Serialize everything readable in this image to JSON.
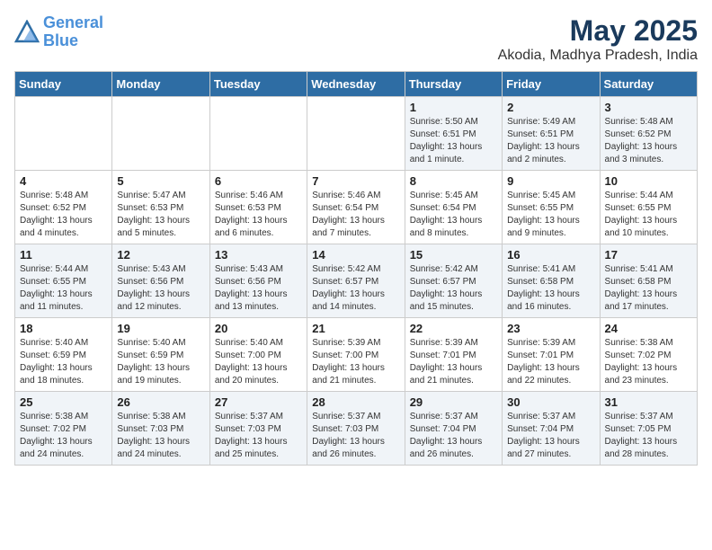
{
  "logo": {
    "line1": "General",
    "line2": "Blue"
  },
  "title": "May 2025",
  "subtitle": "Akodia, Madhya Pradesh, India",
  "weekdays": [
    "Sunday",
    "Monday",
    "Tuesday",
    "Wednesday",
    "Thursday",
    "Friday",
    "Saturday"
  ],
  "weeks": [
    [
      {
        "day": "",
        "info": ""
      },
      {
        "day": "",
        "info": ""
      },
      {
        "day": "",
        "info": ""
      },
      {
        "day": "",
        "info": ""
      },
      {
        "day": "1",
        "info": "Sunrise: 5:50 AM\nSunset: 6:51 PM\nDaylight: 13 hours and 1 minute."
      },
      {
        "day": "2",
        "info": "Sunrise: 5:49 AM\nSunset: 6:51 PM\nDaylight: 13 hours and 2 minutes."
      },
      {
        "day": "3",
        "info": "Sunrise: 5:48 AM\nSunset: 6:52 PM\nDaylight: 13 hours and 3 minutes."
      }
    ],
    [
      {
        "day": "4",
        "info": "Sunrise: 5:48 AM\nSunset: 6:52 PM\nDaylight: 13 hours and 4 minutes."
      },
      {
        "day": "5",
        "info": "Sunrise: 5:47 AM\nSunset: 6:53 PM\nDaylight: 13 hours and 5 minutes."
      },
      {
        "day": "6",
        "info": "Sunrise: 5:46 AM\nSunset: 6:53 PM\nDaylight: 13 hours and 6 minutes."
      },
      {
        "day": "7",
        "info": "Sunrise: 5:46 AM\nSunset: 6:54 PM\nDaylight: 13 hours and 7 minutes."
      },
      {
        "day": "8",
        "info": "Sunrise: 5:45 AM\nSunset: 6:54 PM\nDaylight: 13 hours and 8 minutes."
      },
      {
        "day": "9",
        "info": "Sunrise: 5:45 AM\nSunset: 6:55 PM\nDaylight: 13 hours and 9 minutes."
      },
      {
        "day": "10",
        "info": "Sunrise: 5:44 AM\nSunset: 6:55 PM\nDaylight: 13 hours and 10 minutes."
      }
    ],
    [
      {
        "day": "11",
        "info": "Sunrise: 5:44 AM\nSunset: 6:55 PM\nDaylight: 13 hours and 11 minutes."
      },
      {
        "day": "12",
        "info": "Sunrise: 5:43 AM\nSunset: 6:56 PM\nDaylight: 13 hours and 12 minutes."
      },
      {
        "day": "13",
        "info": "Sunrise: 5:43 AM\nSunset: 6:56 PM\nDaylight: 13 hours and 13 minutes."
      },
      {
        "day": "14",
        "info": "Sunrise: 5:42 AM\nSunset: 6:57 PM\nDaylight: 13 hours and 14 minutes."
      },
      {
        "day": "15",
        "info": "Sunrise: 5:42 AM\nSunset: 6:57 PM\nDaylight: 13 hours and 15 minutes."
      },
      {
        "day": "16",
        "info": "Sunrise: 5:41 AM\nSunset: 6:58 PM\nDaylight: 13 hours and 16 minutes."
      },
      {
        "day": "17",
        "info": "Sunrise: 5:41 AM\nSunset: 6:58 PM\nDaylight: 13 hours and 17 minutes."
      }
    ],
    [
      {
        "day": "18",
        "info": "Sunrise: 5:40 AM\nSunset: 6:59 PM\nDaylight: 13 hours and 18 minutes."
      },
      {
        "day": "19",
        "info": "Sunrise: 5:40 AM\nSunset: 6:59 PM\nDaylight: 13 hours and 19 minutes."
      },
      {
        "day": "20",
        "info": "Sunrise: 5:40 AM\nSunset: 7:00 PM\nDaylight: 13 hours and 20 minutes."
      },
      {
        "day": "21",
        "info": "Sunrise: 5:39 AM\nSunset: 7:00 PM\nDaylight: 13 hours and 21 minutes."
      },
      {
        "day": "22",
        "info": "Sunrise: 5:39 AM\nSunset: 7:01 PM\nDaylight: 13 hours and 21 minutes."
      },
      {
        "day": "23",
        "info": "Sunrise: 5:39 AM\nSunset: 7:01 PM\nDaylight: 13 hours and 22 minutes."
      },
      {
        "day": "24",
        "info": "Sunrise: 5:38 AM\nSunset: 7:02 PM\nDaylight: 13 hours and 23 minutes."
      }
    ],
    [
      {
        "day": "25",
        "info": "Sunrise: 5:38 AM\nSunset: 7:02 PM\nDaylight: 13 hours and 24 minutes."
      },
      {
        "day": "26",
        "info": "Sunrise: 5:38 AM\nSunset: 7:03 PM\nDaylight: 13 hours and 24 minutes."
      },
      {
        "day": "27",
        "info": "Sunrise: 5:37 AM\nSunset: 7:03 PM\nDaylight: 13 hours and 25 minutes."
      },
      {
        "day": "28",
        "info": "Sunrise: 5:37 AM\nSunset: 7:03 PM\nDaylight: 13 hours and 26 minutes."
      },
      {
        "day": "29",
        "info": "Sunrise: 5:37 AM\nSunset: 7:04 PM\nDaylight: 13 hours and 26 minutes."
      },
      {
        "day": "30",
        "info": "Sunrise: 5:37 AM\nSunset: 7:04 PM\nDaylight: 13 hours and 27 minutes."
      },
      {
        "day": "31",
        "info": "Sunrise: 5:37 AM\nSunset: 7:05 PM\nDaylight: 13 hours and 28 minutes."
      }
    ]
  ]
}
